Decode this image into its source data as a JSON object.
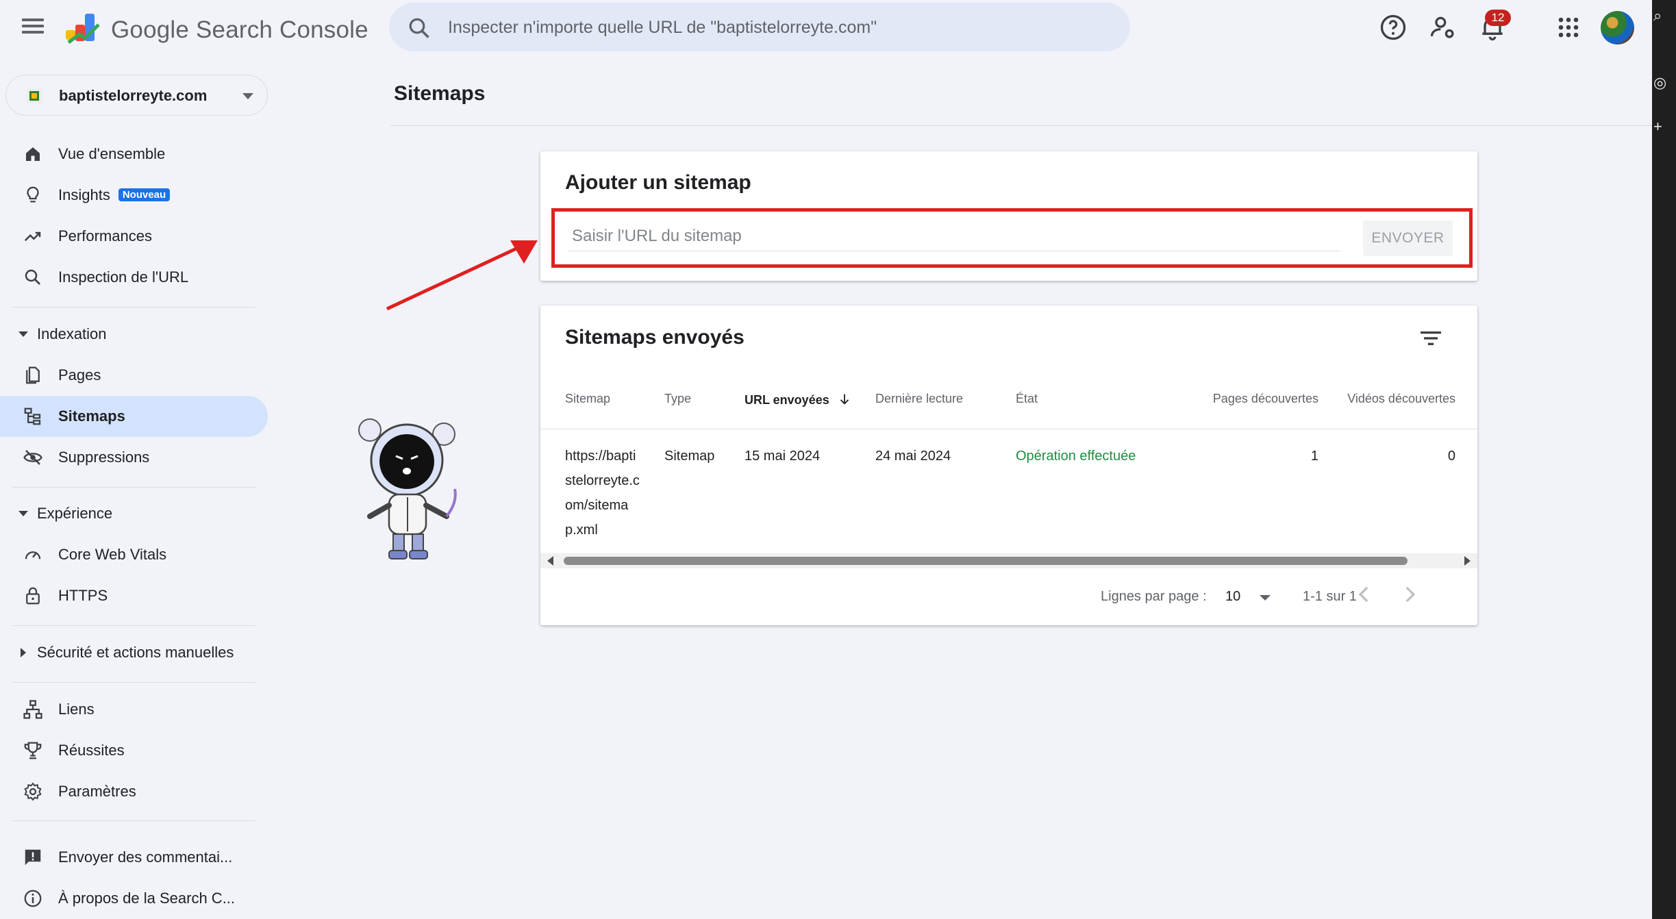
{
  "app": {
    "title": "Google Search Console",
    "search_placeholder": "Inspecter n'importe quelle URL de \"baptistelorreyte.com\"",
    "notification_count": "12"
  },
  "property": {
    "name": "baptistelorreyte.com"
  },
  "sidebar": {
    "items": [
      {
        "label": "Vue d'ensemble",
        "icon": "home-icon"
      },
      {
        "label": "Insights",
        "icon": "lightbulb-icon",
        "badge": "Nouveau"
      },
      {
        "label": "Performances",
        "icon": "trending-up-icon"
      },
      {
        "label": "Inspection de l'URL",
        "icon": "search-icon"
      }
    ],
    "indexation": {
      "label": "Indexation",
      "items": [
        {
          "label": "Pages",
          "icon": "pages-icon"
        },
        {
          "label": "Sitemaps",
          "icon": "sitemap-icon",
          "active": true
        },
        {
          "label": "Suppressions",
          "icon": "eye-off-icon"
        }
      ]
    },
    "experience": {
      "label": "Expérience",
      "items": [
        {
          "label": "Core Web Vitals",
          "icon": "speedometer-icon"
        },
        {
          "label": "HTTPS",
          "icon": "lock-icon"
        }
      ]
    },
    "security": {
      "label": "Sécurité et actions manuelles"
    },
    "more": [
      {
        "label": "Liens",
        "icon": "links-icon"
      },
      {
        "label": "Réussites",
        "icon": "trophy-icon"
      },
      {
        "label": "Paramètres",
        "icon": "gear-icon"
      }
    ],
    "footer": [
      {
        "label": "Envoyer des commentai...",
        "icon": "feedback-icon"
      },
      {
        "label": "À propos de la Search C...",
        "icon": "info-icon"
      }
    ]
  },
  "main": {
    "page_title": "Sitemaps",
    "add_card": {
      "title": "Ajouter un sitemap",
      "input_placeholder": "Saisir l'URL du sitemap",
      "submit_label": "ENVOYER"
    },
    "list_card": {
      "title": "Sitemaps envoyés",
      "columns": [
        "Sitemap",
        "Type",
        "URL envoyées",
        "Dernière lecture",
        "État",
        "Pages découvertes",
        "Vidéos découvertes"
      ],
      "rows": [
        {
          "sitemap": "https://baptistelorreyte.com/sitemap.xml",
          "sitemap_lines": [
            "https://bapti",
            "stelorreyte.c",
            "om/sitema",
            "p.xml"
          ],
          "type": "Sitemap",
          "submitted": "15 mai 2024",
          "last_read": "24 mai 2024",
          "status": "Opération effectuée",
          "pages": "1",
          "videos": "0"
        }
      ],
      "pagination": {
        "rows_per_page_label": "Lignes par page :",
        "rows_per_page": "10",
        "range": "1-1 sur 1"
      }
    }
  },
  "colors": {
    "accent": "#1a73e8",
    "active_nav": "#d3e3fd",
    "success": "#1e8e3e",
    "annotation": "#e02020"
  }
}
